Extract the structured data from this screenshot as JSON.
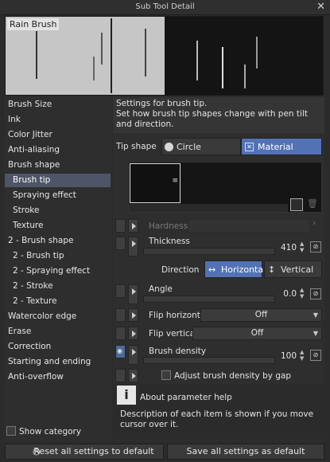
{
  "window": {
    "title": "Sub Tool Detail",
    "close": "✕"
  },
  "preview": {
    "label": "Rain Brush"
  },
  "categories": [
    {
      "label": "Brush Size"
    },
    {
      "label": "Ink"
    },
    {
      "label": "Color Jitter"
    },
    {
      "label": "Anti-aliasing"
    },
    {
      "label": "Brush shape"
    },
    {
      "label": "Brush tip"
    },
    {
      "label": "Spraying effect"
    },
    {
      "label": "Stroke"
    },
    {
      "label": "Texture"
    },
    {
      "label": "2 - Brush shape"
    },
    {
      "label": "2 - Brush tip"
    },
    {
      "label": "2 - Spraying effect"
    },
    {
      "label": "2 - Stroke"
    },
    {
      "label": "2 - Texture"
    },
    {
      "label": "Watercolor edge"
    },
    {
      "label": "Erase"
    },
    {
      "label": "Correction"
    },
    {
      "label": "Starting and ending"
    },
    {
      "label": "Anti-overflow"
    }
  ],
  "show_category": "Show category",
  "header": {
    "title": "Settings for brush tip.",
    "desc": "Set how brush tip shapes change with pen tilt and direction."
  },
  "tip_shape": {
    "label": "Tip shape",
    "circle": "Circle",
    "material": "Material"
  },
  "params": {
    "hardness": "Hardness",
    "thickness": {
      "label": "Thickness",
      "value": "410"
    },
    "direction": {
      "label": "Direction",
      "horizontal": "Horizontal",
      "vertical": "Vertical"
    },
    "angle": {
      "label": "Angle",
      "value": "0.0"
    },
    "flip_h": {
      "label": "Flip horizontal",
      "value": "Off"
    },
    "flip_v": {
      "label": "Flip vertical",
      "value": "Off"
    },
    "density": {
      "label": "Brush density",
      "value": "100"
    },
    "adjust": "Adjust brush density by gap"
  },
  "help": {
    "title": "About parameter help",
    "text": "Description of each item is shown if you move cursor over it."
  },
  "buttons": {
    "reset": "Reset all settings to default",
    "save": "Save all settings as default"
  }
}
